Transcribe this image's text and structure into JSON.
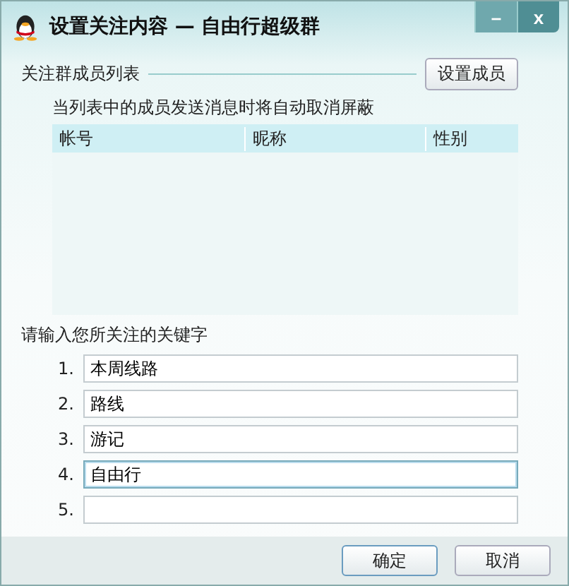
{
  "window": {
    "title": "设置关注内容 — 自由行超级群",
    "controls": [
      {
        "kind": "minimize",
        "label": "–"
      },
      {
        "kind": "close",
        "label": "x"
      }
    ]
  },
  "members": {
    "label": "关注群成员列表",
    "button": "设置成员",
    "hint": "当列表中的成员发送消息时将自动取消屏蔽",
    "columns": [
      "帐号",
      "昵称",
      "性别"
    ]
  },
  "keywords": {
    "label": "请输入您所关注的关键字",
    "fields": [
      {
        "number": "1.",
        "value": "本周线路",
        "focused": false
      },
      {
        "number": "2.",
        "value": "路线",
        "focused": false
      },
      {
        "number": "3.",
        "value": "游记",
        "focused": false
      },
      {
        "number": "4.",
        "value": "自由行",
        "focused": true
      },
      {
        "number": "5.",
        "focused": false
      }
    ]
  },
  "buttons": [
    "确定",
    "取消"
  ]
}
